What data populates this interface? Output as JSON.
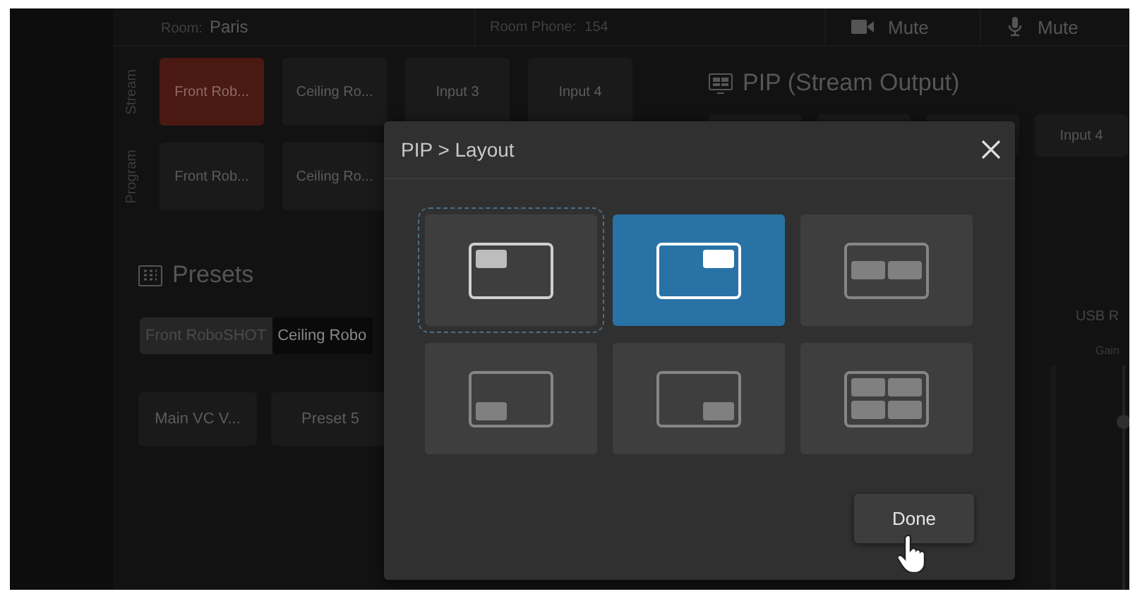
{
  "room": {
    "label": "Room:",
    "value": "Paris"
  },
  "room_phone": {
    "label": "Room Phone:",
    "value": "154"
  },
  "mute_buttons": [
    {
      "kind": "camera",
      "label": "Mute"
    },
    {
      "kind": "microphone",
      "label": "Mute"
    }
  ],
  "source_rows": [
    {
      "label": "Stream",
      "buttons": [
        {
          "label": "Front Rob...",
          "selected": true
        },
        {
          "label": "Ceiling Ro...",
          "selected": false
        },
        {
          "label": "Input 3",
          "selected": false
        },
        {
          "label": "Input 4",
          "selected": false
        }
      ]
    },
    {
      "label": "Program",
      "buttons": [
        {
          "label": "Front Rob...",
          "selected": false
        },
        {
          "label": "Ceiling Ro...",
          "selected": false
        }
      ]
    }
  ],
  "presets": {
    "title": "Presets",
    "tabs": [
      {
        "label": "Front RoboSHOT",
        "selected": true
      },
      {
        "label": "Ceiling Robo",
        "selected": false
      }
    ],
    "buttons": [
      "Main VC V...",
      "Preset 5"
    ]
  },
  "pip": {
    "title": "PIP (Stream Output)",
    "input_button": "Input 4"
  },
  "audio": {
    "title": "USB R",
    "gain_label": "Gain",
    "level": 0.75
  },
  "modal": {
    "title": "PIP > Layout",
    "layouts": [
      {
        "kind": "top-left",
        "selected": false,
        "focused": true
      },
      {
        "kind": "top-right",
        "selected": true,
        "focused": false
      },
      {
        "kind": "side-by-side",
        "selected": false,
        "focused": false
      },
      {
        "kind": "bottom-left",
        "selected": false,
        "focused": false
      },
      {
        "kind": "bottom-right",
        "selected": false,
        "focused": false
      },
      {
        "kind": "quad",
        "selected": false,
        "focused": false
      }
    ],
    "done_button": "Done"
  }
}
